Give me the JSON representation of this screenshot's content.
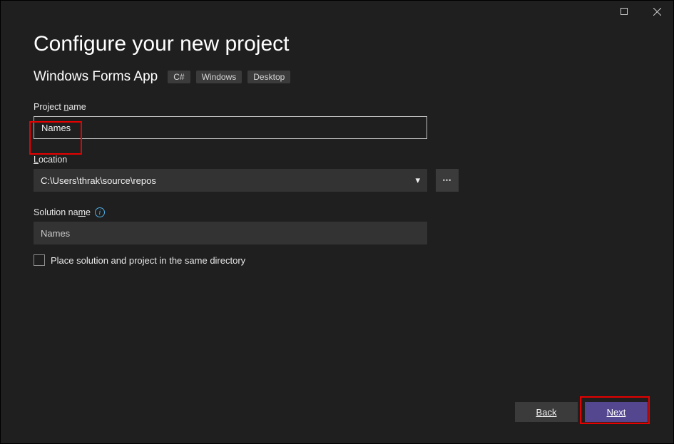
{
  "window": {
    "title": "Configure your new project"
  },
  "template": {
    "name": "Windows Forms App",
    "tags": [
      "C#",
      "Windows",
      "Desktop"
    ]
  },
  "fields": {
    "project_name": {
      "label": "Project name",
      "value": "Names"
    },
    "location": {
      "label": "Location",
      "value": "C:\\Users\\thrak\\source\\repos",
      "browse_label": "..."
    },
    "solution_name": {
      "label": "Solution name",
      "underline": "m",
      "value": "Names"
    },
    "same_dir": {
      "label": "Place solution and project in the same directory",
      "checked": false
    }
  },
  "buttons": {
    "back": "Back",
    "next": "Next"
  },
  "icons": {
    "info": "i",
    "caret": "▾"
  }
}
